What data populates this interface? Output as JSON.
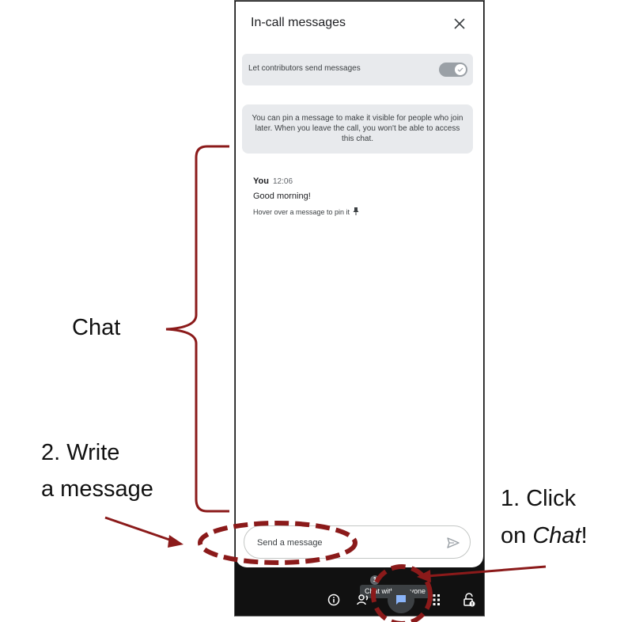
{
  "panel": {
    "title": "In-call messages",
    "toggle_label": "Let contributors send messages",
    "info_text": "You can pin a message to make it visible for people who join later. When you leave the call, you won't be able to access this chat."
  },
  "message": {
    "sender": "You",
    "time": "12:06",
    "text": "Good morning!",
    "hint": "Hover over a message to pin it"
  },
  "input": {
    "placeholder": "Send a message"
  },
  "toolbar": {
    "tooltip": "Chat with everyone",
    "people_badge": "1",
    "icons": [
      "info-icon",
      "people-icon",
      "chat-icon",
      "apps-icon",
      "lock-icon"
    ]
  },
  "annotations": {
    "chat_label": "Chat",
    "step2_line1": "2. Write",
    "step2_line2": "a message",
    "step1_line1": "1. Click",
    "step1_prefix": "on ",
    "step1_emph": "Chat",
    "step1_suffix": "!"
  },
  "colors": {
    "annotation": "#8b1a1a",
    "toolbar_bg": "#111111",
    "chip_bg": "#e8eaed"
  }
}
